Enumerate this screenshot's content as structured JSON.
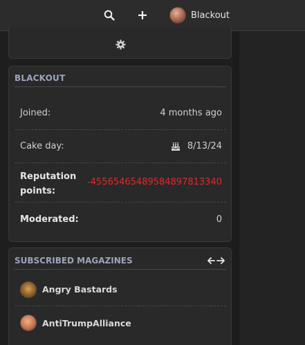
{
  "header": {
    "search_icon": "search-icon",
    "add_icon": "plus-icon",
    "username": "Blackout"
  },
  "user_card": {
    "title": "BLACKOUT",
    "joined_label": "Joined:",
    "joined_value": "4 months ago",
    "cakeday_label": "Cake day:",
    "cakeday_value": "8/13/24",
    "reputation_label": "Reputation points:",
    "reputation_value": "-4556546548958489781334 0",
    "moderated_label": "Moderated:",
    "moderated_value": "0"
  },
  "magazines": {
    "title": "SUBSCRIBED MAGAZINES",
    "items": [
      {
        "name": "Angry Bastards"
      },
      {
        "name": "AntiTrumpAlliance"
      }
    ]
  },
  "colors": {
    "reputation_negative": "#e02a2a",
    "section_title": "#9aa5b8"
  }
}
